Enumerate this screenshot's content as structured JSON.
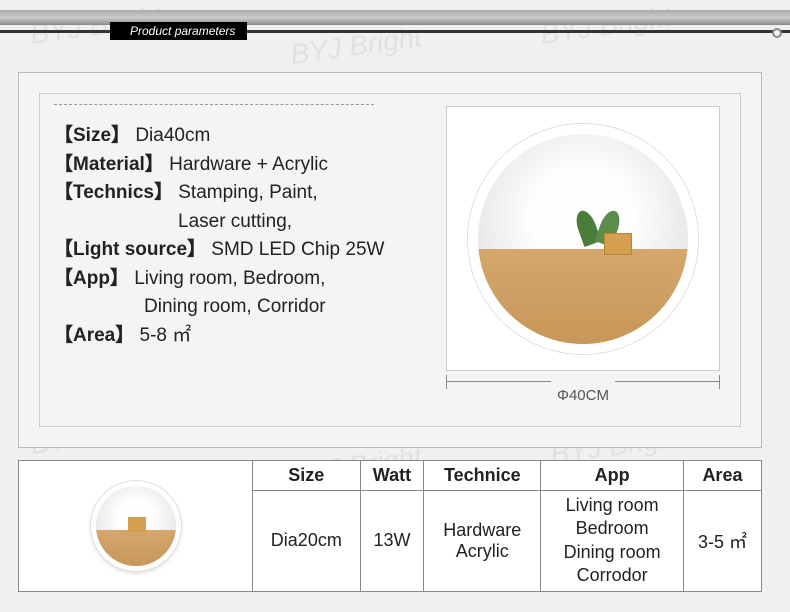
{
  "watermark": "BYJ Bright",
  "header": "Product parameters",
  "specs": {
    "size_label": "【Size】",
    "size_value": "Dia40cm",
    "material_label": "【Material】",
    "material_value": "Hardware + Acrylic",
    "technics_label": "【Technics】",
    "technics_value1": "Stamping, Paint,",
    "technics_value2": "Laser cutting,",
    "light_label": "【Light source】",
    "light_value": "SMD LED Chip 25W",
    "app_label": "【App】",
    "app_value1": "Living room, Bedroom,",
    "app_value2": "Dining room, Corridor",
    "area_label": "【Area】",
    "area_value": "5-8 ㎡"
  },
  "dimension": "Φ40CM",
  "table": {
    "headers": {
      "size": "Size",
      "watt": "Watt",
      "technice": "Technice",
      "app": "App",
      "area": "Area"
    },
    "row": {
      "size": "Dia20cm",
      "watt": "13W",
      "technice_l1": "Hardware",
      "technice_l2": "Acrylic",
      "app_l1": "Living room",
      "app_l2": "Bedroom",
      "app_l3": "Dining room",
      "app_l4": "Corrodor",
      "area": "3-5 ㎡"
    }
  }
}
